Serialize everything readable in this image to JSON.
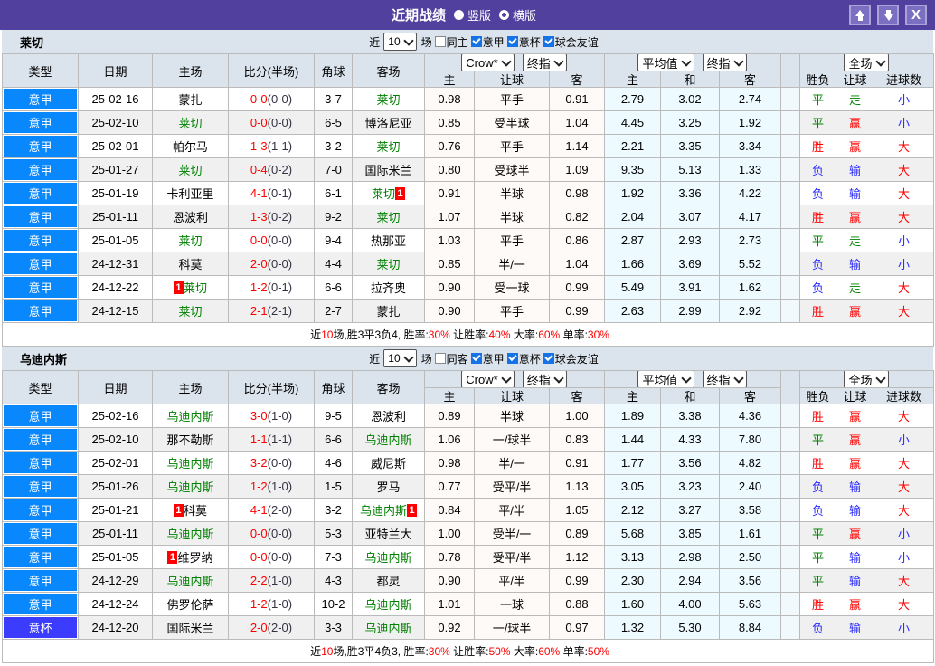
{
  "titlebar": {
    "title": "近期战绩",
    "vertical_label": "竖版",
    "horizontal_label": "横版",
    "up_icon": "↑",
    "down_icon": "↓",
    "close_icon": "X"
  },
  "labels": {
    "recent": "近",
    "matches": "场",
    "leagues": [
      "意甲",
      "意杯",
      "球会友谊"
    ]
  },
  "dropdowns": {
    "company": "Crow*",
    "final": "终指",
    "average": "平均值",
    "final2": "终指",
    "scope": "全场"
  },
  "columns": {
    "type": "类型",
    "date": "日期",
    "home": "主场",
    "score": "比分(半场)",
    "corner": "角球",
    "away": "客场",
    "odds_home": "主",
    "odds_handicap": "让球",
    "odds_away": "客",
    "avg_home": "主",
    "avg_draw": "和",
    "avg_away": "客",
    "result_wdl": "胜负",
    "result_handicap": "让球",
    "result_goals": "进球数"
  },
  "tables": [
    {
      "team": "莱切",
      "filter": {
        "count": "10",
        "same_label": "同主",
        "same_checked": false,
        "league_checked": [
          true,
          true,
          true
        ]
      },
      "rows": [
        {
          "league": "意甲",
          "cup": false,
          "date": "25-02-16",
          "home": "蒙扎",
          "home_focal": false,
          "home_card": "",
          "away": "莱切",
          "away_focal": true,
          "away_card": "",
          "ft": "0-0",
          "ht": "(0-0)",
          "corner": "3-7",
          "o": [
            "0.98",
            "平手",
            "0.91"
          ],
          "g": [
            "2.79",
            "3.02",
            "2.74"
          ],
          "r": [
            [
              "平",
              "g"
            ],
            [
              "走",
              "g"
            ],
            [
              "小",
              "b"
            ]
          ]
        },
        {
          "league": "意甲",
          "cup": false,
          "date": "25-02-10",
          "home": "莱切",
          "home_focal": true,
          "home_card": "",
          "away": "博洛尼亚",
          "away_focal": false,
          "away_card": "",
          "ft": "0-0",
          "ht": "(0-0)",
          "corner": "6-5",
          "o": [
            "0.85",
            "受半球",
            "1.04"
          ],
          "g": [
            "4.45",
            "3.25",
            "1.92"
          ],
          "r": [
            [
              "平",
              "g"
            ],
            [
              "赢",
              "r"
            ],
            [
              "小",
              "b"
            ]
          ]
        },
        {
          "league": "意甲",
          "cup": false,
          "date": "25-02-01",
          "home": "帕尔马",
          "home_focal": false,
          "home_card": "",
          "away": "莱切",
          "away_focal": true,
          "away_card": "",
          "ft": "1-3",
          "ht": "(1-1)",
          "corner": "3-2",
          "o": [
            "0.76",
            "平手",
            "1.14"
          ],
          "g": [
            "2.21",
            "3.35",
            "3.34"
          ],
          "r": [
            [
              "胜",
              "r"
            ],
            [
              "赢",
              "r"
            ],
            [
              "大",
              "r"
            ]
          ]
        },
        {
          "league": "意甲",
          "cup": false,
          "date": "25-01-27",
          "home": "莱切",
          "home_focal": true,
          "home_card": "",
          "away": "国际米兰",
          "away_focal": false,
          "away_card": "",
          "ft": "0-4",
          "ht": "(0-2)",
          "corner": "7-0",
          "o": [
            "0.80",
            "受球半",
            "1.09"
          ],
          "g": [
            "9.35",
            "5.13",
            "1.33"
          ],
          "r": [
            [
              "负",
              "b"
            ],
            [
              "输",
              "b"
            ],
            [
              "大",
              "r"
            ]
          ]
        },
        {
          "league": "意甲",
          "cup": false,
          "date": "25-01-19",
          "home": "卡利亚里",
          "home_focal": false,
          "home_card": "",
          "away": "莱切",
          "away_focal": true,
          "away_card": "1",
          "ft": "4-1",
          "ht": "(0-1)",
          "corner": "6-1",
          "o": [
            "0.91",
            "半球",
            "0.98"
          ],
          "g": [
            "1.92",
            "3.36",
            "4.22"
          ],
          "r": [
            [
              "负",
              "b"
            ],
            [
              "输",
              "b"
            ],
            [
              "大",
              "r"
            ]
          ]
        },
        {
          "league": "意甲",
          "cup": false,
          "date": "25-01-11",
          "home": "恩波利",
          "home_focal": false,
          "home_card": "",
          "away": "莱切",
          "away_focal": true,
          "away_card": "",
          "ft": "1-3",
          "ht": "(0-2)",
          "corner": "9-2",
          "o": [
            "1.07",
            "半球",
            "0.82"
          ],
          "g": [
            "2.04",
            "3.07",
            "4.17"
          ],
          "r": [
            [
              "胜",
              "r"
            ],
            [
              "赢",
              "r"
            ],
            [
              "大",
              "r"
            ]
          ]
        },
        {
          "league": "意甲",
          "cup": false,
          "date": "25-01-05",
          "home": "莱切",
          "home_focal": true,
          "home_card": "",
          "away": "热那亚",
          "away_focal": false,
          "away_card": "",
          "ft": "0-0",
          "ht": "(0-0)",
          "corner": "9-4",
          "o": [
            "1.03",
            "平手",
            "0.86"
          ],
          "g": [
            "2.87",
            "2.93",
            "2.73"
          ],
          "r": [
            [
              "平",
              "g"
            ],
            [
              "走",
              "g"
            ],
            [
              "小",
              "b"
            ]
          ]
        },
        {
          "league": "意甲",
          "cup": false,
          "date": "24-12-31",
          "home": "科莫",
          "home_focal": false,
          "home_card": "",
          "away": "莱切",
          "away_focal": true,
          "away_card": "",
          "ft": "2-0",
          "ht": "(0-0)",
          "corner": "4-4",
          "o": [
            "0.85",
            "半/一",
            "1.04"
          ],
          "g": [
            "1.66",
            "3.69",
            "5.52"
          ],
          "r": [
            [
              "负",
              "b"
            ],
            [
              "输",
              "b"
            ],
            [
              "小",
              "b"
            ]
          ]
        },
        {
          "league": "意甲",
          "cup": false,
          "date": "24-12-22",
          "home": "莱切",
          "home_focal": true,
          "home_card": "1",
          "away": "拉齐奥",
          "away_focal": false,
          "away_card": "",
          "ft": "1-2",
          "ht": "(0-1)",
          "corner": "6-6",
          "o": [
            "0.90",
            "受一球",
            "0.99"
          ],
          "g": [
            "5.49",
            "3.91",
            "1.62"
          ],
          "r": [
            [
              "负",
              "b"
            ],
            [
              "走",
              "g"
            ],
            [
              "大",
              "r"
            ]
          ]
        },
        {
          "league": "意甲",
          "cup": false,
          "date": "24-12-15",
          "home": "莱切",
          "home_focal": true,
          "home_card": "",
          "away": "蒙扎",
          "away_focal": false,
          "away_card": "",
          "ft": "2-1",
          "ht": "(2-1)",
          "corner": "2-7",
          "o": [
            "0.90",
            "平手",
            "0.99"
          ],
          "g": [
            "2.63",
            "2.99",
            "2.92"
          ],
          "r": [
            [
              "胜",
              "r"
            ],
            [
              "赢",
              "r"
            ],
            [
              "大",
              "r"
            ]
          ]
        }
      ],
      "summary": [
        {
          "t": "近",
          "red": false
        },
        {
          "t": "10",
          "red": true
        },
        {
          "t": "场,胜3平3负4, 胜率:",
          "red": false
        },
        {
          "t": "30%",
          "red": true
        },
        {
          "t": " 让胜率:",
          "red": false
        },
        {
          "t": "40%",
          "red": true
        },
        {
          "t": " 大率:",
          "red": false
        },
        {
          "t": "60%",
          "red": true
        },
        {
          "t": " 单率:",
          "red": false
        },
        {
          "t": "30%",
          "red": true
        }
      ]
    },
    {
      "team": "乌迪内斯",
      "filter": {
        "count": "10",
        "same_label": "同客",
        "same_checked": false,
        "league_checked": [
          true,
          true,
          true
        ]
      },
      "rows": [
        {
          "league": "意甲",
          "cup": false,
          "date": "25-02-16",
          "home": "乌迪内斯",
          "home_focal": true,
          "home_card": "",
          "away": "恩波利",
          "away_focal": false,
          "away_card": "",
          "ft": "3-0",
          "ht": "(1-0)",
          "corner": "9-5",
          "o": [
            "0.89",
            "半球",
            "1.00"
          ],
          "g": [
            "1.89",
            "3.38",
            "4.36"
          ],
          "r": [
            [
              "胜",
              "r"
            ],
            [
              "赢",
              "r"
            ],
            [
              "大",
              "r"
            ]
          ]
        },
        {
          "league": "意甲",
          "cup": false,
          "date": "25-02-10",
          "home": "那不勒斯",
          "home_focal": false,
          "home_card": "",
          "away": "乌迪内斯",
          "away_focal": true,
          "away_card": "",
          "ft": "1-1",
          "ht": "(1-1)",
          "corner": "6-6",
          "o": [
            "1.06",
            "一/球半",
            "0.83"
          ],
          "g": [
            "1.44",
            "4.33",
            "7.80"
          ],
          "r": [
            [
              "平",
              "g"
            ],
            [
              "赢",
              "r"
            ],
            [
              "小",
              "b"
            ]
          ]
        },
        {
          "league": "意甲",
          "cup": false,
          "date": "25-02-01",
          "home": "乌迪内斯",
          "home_focal": true,
          "home_card": "",
          "away": "威尼斯",
          "away_focal": false,
          "away_card": "",
          "ft": "3-2",
          "ht": "(0-0)",
          "corner": "4-6",
          "o": [
            "0.98",
            "半/一",
            "0.91"
          ],
          "g": [
            "1.77",
            "3.56",
            "4.82"
          ],
          "r": [
            [
              "胜",
              "r"
            ],
            [
              "赢",
              "r"
            ],
            [
              "大",
              "r"
            ]
          ]
        },
        {
          "league": "意甲",
          "cup": false,
          "date": "25-01-26",
          "home": "乌迪内斯",
          "home_focal": true,
          "home_card": "",
          "away": "罗马",
          "away_focal": false,
          "away_card": "",
          "ft": "1-2",
          "ht": "(1-0)",
          "corner": "1-5",
          "o": [
            "0.77",
            "受平/半",
            "1.13"
          ],
          "g": [
            "3.05",
            "3.23",
            "2.40"
          ],
          "r": [
            [
              "负",
              "b"
            ],
            [
              "输",
              "b"
            ],
            [
              "大",
              "r"
            ]
          ]
        },
        {
          "league": "意甲",
          "cup": false,
          "date": "25-01-21",
          "home": "科莫",
          "home_focal": false,
          "home_card": "1",
          "away": "乌迪内斯",
          "away_focal": true,
          "away_card": "1",
          "ft": "4-1",
          "ht": "(2-0)",
          "corner": "3-2",
          "o": [
            "0.84",
            "平/半",
            "1.05"
          ],
          "g": [
            "2.12",
            "3.27",
            "3.58"
          ],
          "r": [
            [
              "负",
              "b"
            ],
            [
              "输",
              "b"
            ],
            [
              "大",
              "r"
            ]
          ]
        },
        {
          "league": "意甲",
          "cup": false,
          "date": "25-01-11",
          "home": "乌迪内斯",
          "home_focal": true,
          "home_card": "",
          "away": "亚特兰大",
          "away_focal": false,
          "away_card": "",
          "ft": "0-0",
          "ht": "(0-0)",
          "corner": "5-3",
          "o": [
            "1.00",
            "受半/一",
            "0.89"
          ],
          "g": [
            "5.68",
            "3.85",
            "1.61"
          ],
          "r": [
            [
              "平",
              "g"
            ],
            [
              "赢",
              "r"
            ],
            [
              "小",
              "b"
            ]
          ]
        },
        {
          "league": "意甲",
          "cup": false,
          "date": "25-01-05",
          "home": "维罗纳",
          "home_focal": false,
          "home_card": "1",
          "away": "乌迪内斯",
          "away_focal": true,
          "away_card": "",
          "ft": "0-0",
          "ht": "(0-0)",
          "corner": "7-3",
          "o": [
            "0.78",
            "受平/半",
            "1.12"
          ],
          "g": [
            "3.13",
            "2.98",
            "2.50"
          ],
          "r": [
            [
              "平",
              "g"
            ],
            [
              "输",
              "b"
            ],
            [
              "小",
              "b"
            ]
          ]
        },
        {
          "league": "意甲",
          "cup": false,
          "date": "24-12-29",
          "home": "乌迪内斯",
          "home_focal": true,
          "home_card": "",
          "away": "都灵",
          "away_focal": false,
          "away_card": "",
          "ft": "2-2",
          "ht": "(1-0)",
          "corner": "4-3",
          "o": [
            "0.90",
            "平/半",
            "0.99"
          ],
          "g": [
            "2.30",
            "2.94",
            "3.56"
          ],
          "r": [
            [
              "平",
              "g"
            ],
            [
              "输",
              "b"
            ],
            [
              "大",
              "r"
            ]
          ]
        },
        {
          "league": "意甲",
          "cup": false,
          "date": "24-12-24",
          "home": "佛罗伦萨",
          "home_focal": false,
          "home_card": "",
          "away": "乌迪内斯",
          "away_focal": true,
          "away_card": "",
          "ft": "1-2",
          "ht": "(1-0)",
          "corner": "10-2",
          "o": [
            "1.01",
            "一球",
            "0.88"
          ],
          "g": [
            "1.60",
            "4.00",
            "5.63"
          ],
          "r": [
            [
              "胜",
              "r"
            ],
            [
              "赢",
              "r"
            ],
            [
              "大",
              "r"
            ]
          ]
        },
        {
          "league": "意杯",
          "cup": true,
          "date": "24-12-20",
          "home": "国际米兰",
          "home_focal": false,
          "home_card": "",
          "away": "乌迪内斯",
          "away_focal": true,
          "away_card": "",
          "ft": "2-0",
          "ht": "(2-0)",
          "corner": "3-3",
          "o": [
            "0.92",
            "一/球半",
            "0.97"
          ],
          "g": [
            "1.32",
            "5.30",
            "8.84"
          ],
          "r": [
            [
              "负",
              "b"
            ],
            [
              "输",
              "b"
            ],
            [
              "小",
              "b"
            ]
          ]
        }
      ],
      "summary": [
        {
          "t": "近",
          "red": false
        },
        {
          "t": "10",
          "red": true
        },
        {
          "t": "场,胜3平4负3, 胜率:",
          "red": false
        },
        {
          "t": "30%",
          "red": true
        },
        {
          "t": " 让胜率:",
          "red": false
        },
        {
          "t": "50%",
          "red": true
        },
        {
          "t": " 大率:",
          "red": false
        },
        {
          "t": "60%",
          "red": true
        },
        {
          "t": " 单率:",
          "red": false
        },
        {
          "t": "50%",
          "red": true
        }
      ]
    }
  ]
}
